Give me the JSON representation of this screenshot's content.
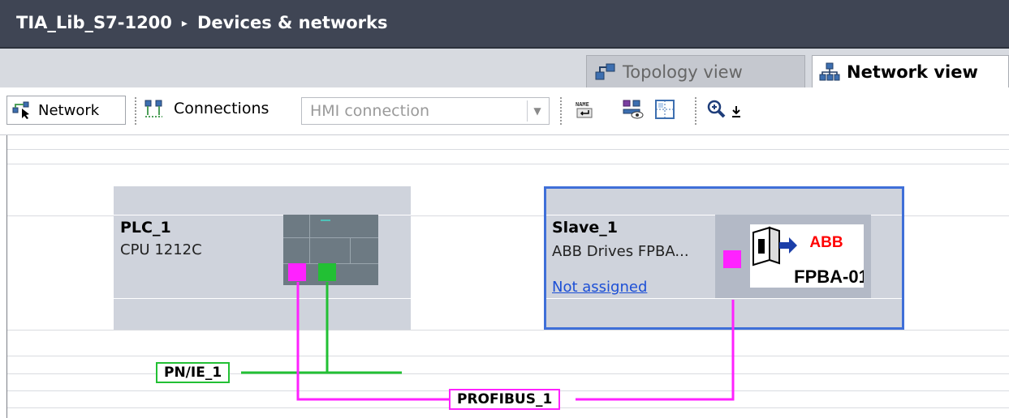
{
  "titlebar": {
    "project": "TIA_Lib_S7-1200",
    "separator": "▸",
    "page": "Devices & networks"
  },
  "view_tabs": [
    {
      "label": "Topology view",
      "icon": "topology-icon",
      "active": false
    },
    {
      "label": "Network view",
      "icon": "network-view-icon",
      "active": true
    }
  ],
  "toolbar": {
    "network_label": "Network",
    "connections_label": "Connections",
    "connection_type_value": "HMI connection",
    "icons": [
      "show-names-icon",
      "highlight-icon",
      "grid-icon",
      "zoom-in-icon"
    ]
  },
  "devices": {
    "plc": {
      "name": "PLC_1",
      "type": "CPU 1212C"
    },
    "slave": {
      "name": "Slave_1",
      "type": "ABB Drives FPBA...",
      "status": "Not assigned"
    }
  },
  "module": {
    "brand": "ABB",
    "label": "FPBA-01"
  },
  "networks": {
    "profinet": {
      "label": "PN/IE_1",
      "color": "#22c034"
    },
    "profibus": {
      "label": "PROFIBUS_1",
      "color": "#ff22ff"
    }
  },
  "colors": {
    "accent_selection": "#3f6fd8",
    "title_bg": "#3f4554"
  }
}
